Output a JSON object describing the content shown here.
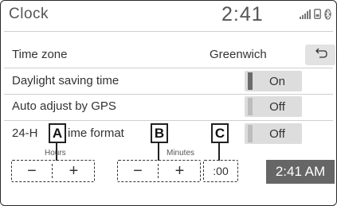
{
  "header": {
    "title": "Clock",
    "time": "2:41",
    "status_icons": [
      "signal-icon",
      "phone-icon",
      "bluetooth-icon"
    ]
  },
  "rows": [
    {
      "label": "Time zone",
      "value": "Greenwich"
    },
    {
      "label": "Daylight saving time",
      "toggle": "On"
    },
    {
      "label": "Auto adjust by GPS",
      "toggle": "Off"
    },
    {
      "label_prefix": "24-H",
      "label_suffix": "ime format",
      "toggle": "Off"
    }
  ],
  "callouts": [
    "A",
    "B",
    "C"
  ],
  "hours": {
    "label": "Hours",
    "minus": "−",
    "plus": "+"
  },
  "minutes": {
    "label": "Minutes",
    "minus": "−",
    "plus": "+"
  },
  "zero_button": ":00",
  "preview_time": "2:41 AM",
  "colors": {
    "toggle_on_indicator": "#6b6b6b",
    "toggle_off_indicator": "#bdbdbd",
    "preview_bg": "#666666"
  }
}
